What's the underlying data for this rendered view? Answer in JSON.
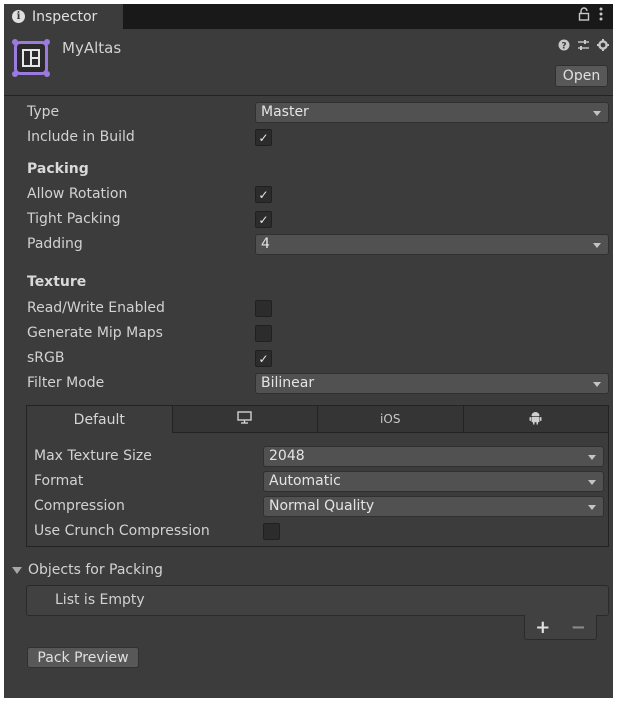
{
  "tab": {
    "title": "Inspector",
    "icon": "info-icon"
  },
  "tab_tools": {
    "lock": "lock-icon",
    "menu": "kebab-menu-icon"
  },
  "asset": {
    "name": "MyAltas",
    "icon": "sprite-atlas-icon"
  },
  "header_icons": [
    "help-icon",
    "presets-icon",
    "settings-gear-icon"
  ],
  "open_label": "Open",
  "fields": {
    "type": {
      "label": "Type",
      "value": "Master"
    },
    "include_in_build": {
      "label": "Include in Build",
      "checked": true
    }
  },
  "packing": {
    "heading": "Packing",
    "allow_rotation": {
      "label": "Allow Rotation",
      "checked": true
    },
    "tight_packing": {
      "label": "Tight Packing",
      "checked": true
    },
    "padding": {
      "label": "Padding",
      "value": "4"
    }
  },
  "texture": {
    "heading": "Texture",
    "read_write": {
      "label": "Read/Write Enabled",
      "checked": false
    },
    "mip_maps": {
      "label": "Generate Mip Maps",
      "checked": false
    },
    "srgb": {
      "label": "sRGB",
      "checked": true
    },
    "filter_mode": {
      "label": "Filter Mode",
      "value": "Bilinear"
    }
  },
  "platform": {
    "tabs": [
      {
        "label": "Default",
        "icon": "",
        "active": true
      },
      {
        "label": "",
        "icon": "monitor-icon",
        "active": false
      },
      {
        "label": "iOS",
        "icon": "",
        "active": false
      },
      {
        "label": "",
        "icon": "android-icon",
        "active": false
      }
    ],
    "max_texture_size": {
      "label": "Max Texture Size",
      "value": "2048"
    },
    "format": {
      "label": "Format",
      "value": "Automatic"
    },
    "compression": {
      "label": "Compression",
      "value": "Normal Quality"
    },
    "crunch": {
      "label": "Use Crunch Compression",
      "checked": false
    }
  },
  "objects": {
    "heading": "Objects for Packing",
    "empty_text": "List is Empty",
    "add": "+",
    "remove": "−"
  },
  "pack_preview_label": "Pack Preview",
  "colors": {
    "panel": "#3c3c3c",
    "accent_icon": "#9b7be0",
    "field": "#515151"
  }
}
